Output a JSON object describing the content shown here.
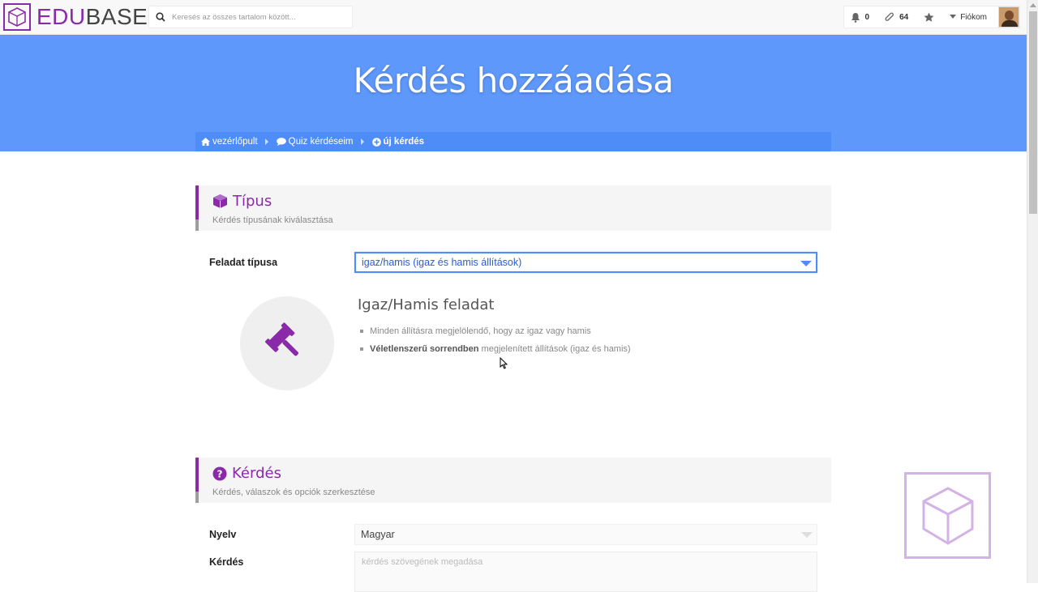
{
  "brand": {
    "edu": "EDU",
    "base": "BASE"
  },
  "search": {
    "placeholder": "Keresés az összes tartalom között..."
  },
  "nav": {
    "notifications_count": "0",
    "attachments_count": "64",
    "account_label": "Fiókom"
  },
  "hero": {
    "title": "Kérdés hozzáadása"
  },
  "breadcrumb": [
    {
      "label": "vezérlőpult",
      "icon": "home-icon"
    },
    {
      "label": "Quiz kérdéseim",
      "icon": "comment-icon"
    },
    {
      "label": "új kérdés",
      "icon": "plus-circle-icon"
    }
  ],
  "type_section": {
    "title": "Típus",
    "subtitle": "Kérdés típusának kiválasztása",
    "field_label": "Feladat típusa",
    "selected": "igaz/hamis (igaz és hamis állítások)",
    "task_title": "Igaz/Hamis feladat",
    "bullet1": "Minden állításra megjelölendő, hogy az igaz vagy hamis",
    "bullet2_bold": "Véletlenszerű sorrendben",
    "bullet2_rest": " megjelenített állítások (igaz és hamis)"
  },
  "question_section": {
    "title": "Kérdés",
    "subtitle": "Kérdés, válaszok és opciók szerkesztése",
    "language_label": "Nyelv",
    "language_value": "Magyar",
    "question_label": "Kérdés",
    "question_placeholder": "kérdés szövegének megadása"
  },
  "colors": {
    "accent": "#8a2aa8",
    "hero": "#5e98fa",
    "breadcrumb": "#4e8cf7"
  }
}
